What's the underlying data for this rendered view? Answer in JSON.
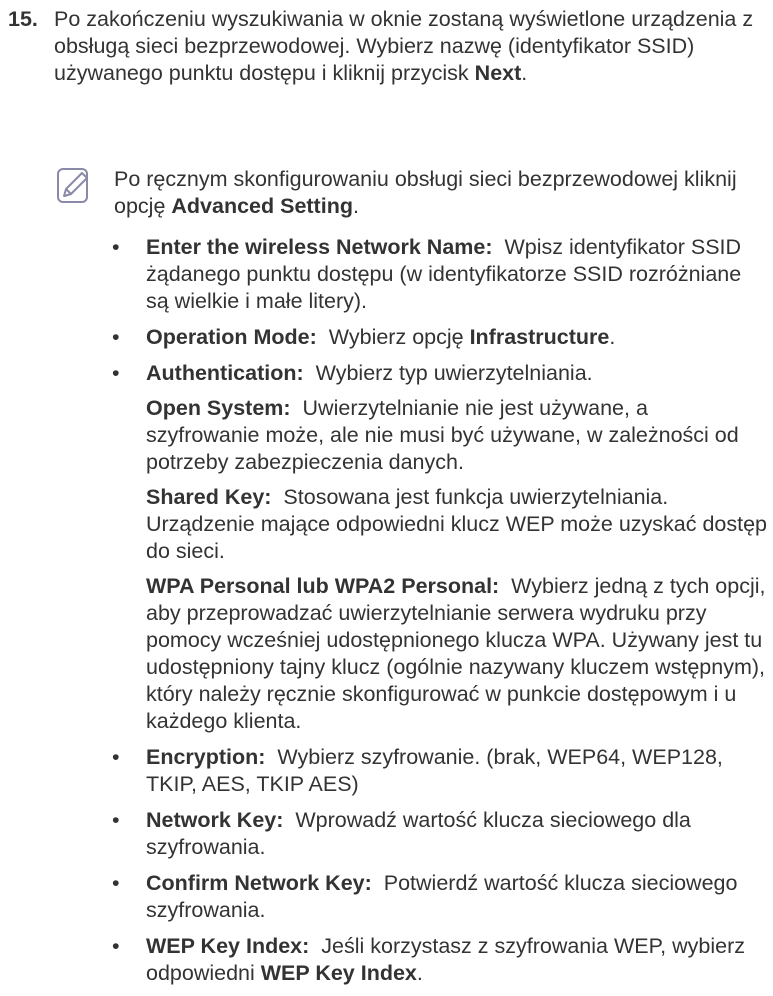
{
  "step": {
    "number": "15.",
    "text_before": "Po zakończeniu wyszukiwania w oknie zostaną wyświetlone urządzenia z obsługą sieci bezprzewodowej. Wybierz nazwę (identyfikator SSID) używanego punktu dostępu i kliknij przycisk ",
    "next_label": "Next",
    "text_after": "."
  },
  "note": {
    "icon": "note-pencil-icon",
    "text_before": "Po ręcznym skonfigurowaniu obsługi sieci bezprzewodowej kliknij opcję ",
    "advanced_label": "Advanced Setting",
    "text_after": "."
  },
  "bullet_char": "•",
  "items": [
    {
      "term": "Enter the wireless Network Name:",
      "text": "Wpisz identyfikator SSID żądanego punktu dostępu (w identyfikatorze SSID rozróżniane są wielkie i małe litery)."
    },
    {
      "term": "Operation Mode:",
      "text": "Wybierz opcję ",
      "strong": "Infrastructure",
      "end": "."
    },
    {
      "term": "Authentication:",
      "text": "Wybierz typ uwierzytelniania."
    },
    {
      "term": "Encryption:",
      "text": "Wybierz szyfrowanie. (brak, WEP64, WEP128, TKIP, AES, TKIP AES)"
    },
    {
      "term": "Network Key:",
      "text": "Wprowadź wartość klucza sieciowego dla szyfrowania."
    },
    {
      "term": "Confirm Network Key:",
      "text": "Potwierdź wartość klucza sieciowego szyfrowania."
    },
    {
      "term": "WEP Key Index:",
      "text": "Jeśli korzystasz z szyfrowania WEP, wybierz odpowiedni ",
      "strong": "WEP Key Index",
      "end": "."
    }
  ],
  "auth_sub": [
    {
      "term": "Open System:",
      "text": "Uwierzytelnianie nie jest używane, a szyfrowanie może, ale nie musi być używane, w zależności od potrzeby zabezpieczenia danych."
    },
    {
      "term": "Shared Key:",
      "text": "Stosowana jest funkcja uwierzytelniania. Urządzenie mające odpowiedni klucz WEP może uzyskać dostęp do sieci."
    },
    {
      "term": "WPA Personal lub WPA2 Personal:",
      "text": "Wybierz jedną z tych opcji, aby przeprowadzać uwierzytelnianie serwera wydruku przy pomocy wcześniej udostępnionego klucza WPA. Używany jest tu udostępniony tajny klucz (ogólnie nazywany kluczem wstępnym), który należy ręcznie skonfigurować w punkcie dostępowym i u każdego klienta."
    }
  ]
}
